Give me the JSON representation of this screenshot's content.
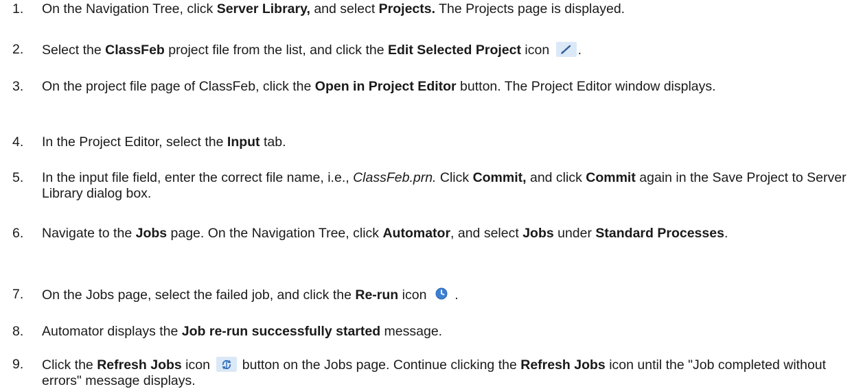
{
  "steps": [
    {
      "num": "1.",
      "parts": [
        {
          "t": "On the Navigation Tree, click "
        },
        {
          "t": "Server Library,",
          "s": "b"
        },
        {
          "t": " and select "
        },
        {
          "t": "Projects.",
          "s": "b"
        },
        {
          "t": " The Projects page is displayed."
        }
      ]
    },
    {
      "num": "2.",
      "parts": [
        {
          "t": "Select the "
        },
        {
          "t": "ClassFeb",
          "s": "b"
        },
        {
          "t": " project file from the list, and click the "
        },
        {
          "t": "Edit Selected Project",
          "s": "b"
        },
        {
          "t": " icon "
        },
        {
          "icon": "pencil-icon"
        },
        {
          "t": "."
        }
      ]
    },
    {
      "num": "3.",
      "parts": [
        {
          "t": "On the project file page of ClassFeb, click the "
        },
        {
          "t": "Open in Project Editor",
          "s": "b"
        },
        {
          "t": " button. The Project Editor window displays."
        }
      ]
    },
    {
      "num": "4.",
      "parts": [
        {
          "t": "In the Project Editor, select the "
        },
        {
          "t": "Input",
          "s": "b"
        },
        {
          "t": " tab."
        }
      ]
    },
    {
      "num": "5.",
      "parts": [
        {
          "t": "In the input file field, enter the correct file name, i.e., "
        },
        {
          "t": "ClassFeb.prn.",
          "s": "i"
        },
        {
          "t": " Click "
        },
        {
          "t": "Commit,",
          "s": "b"
        },
        {
          "t": " and click "
        },
        {
          "t": "Commit",
          "s": "b"
        },
        {
          "t": " again in the Save Project to Server Library dialog box."
        }
      ]
    },
    {
      "num": "6.",
      "parts": [
        {
          "t": "Navigate to the "
        },
        {
          "t": "Jobs",
          "s": "b"
        },
        {
          "t": " page. On the Navigation Tree, click "
        },
        {
          "t": "Automator",
          "s": "b"
        },
        {
          "t": ", and select "
        },
        {
          "t": "Jobs",
          "s": "b"
        },
        {
          "t": " under "
        },
        {
          "t": "Standard Processes",
          "s": "b"
        },
        {
          "t": "."
        }
      ]
    },
    {
      "num": "7.",
      "parts": [
        {
          "t": "On the Jobs page, select the failed job, and click the "
        },
        {
          "t": "Re-run",
          "s": "b"
        },
        {
          "t": " icon "
        },
        {
          "icon": "clock-icon"
        },
        {
          "t": " ."
        }
      ]
    },
    {
      "num": "8.",
      "parts": [
        {
          "t": "Automator displays the "
        },
        {
          "t": "Job re-run successfully started",
          "s": "b"
        },
        {
          "t": " message."
        }
      ]
    },
    {
      "num": "9.",
      "parts": [
        {
          "t": "Click the "
        },
        {
          "t": "Refresh Jobs",
          "s": "b"
        },
        {
          "t": " icon "
        },
        {
          "icon": "refresh-icon"
        },
        {
          "t": " button on the Jobs page. Continue clicking the "
        },
        {
          "t": "Refresh Jobs",
          "s": "b"
        },
        {
          "t": " icon until the \"Job completed without errors\" message displays."
        }
      ]
    }
  ]
}
